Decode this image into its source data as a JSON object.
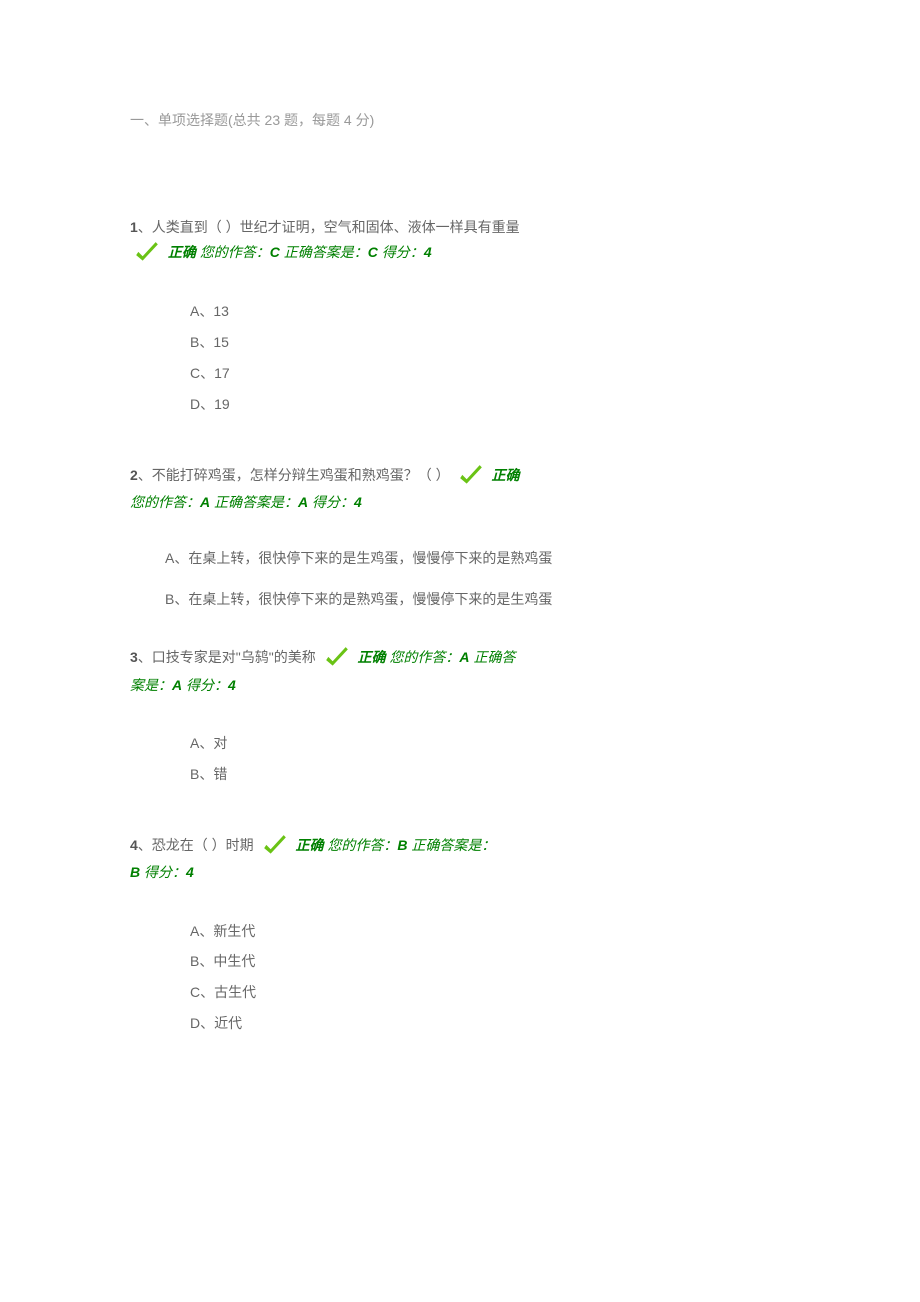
{
  "section_title": "一、单项选择题(总共 23 题，每题 4 分)",
  "correct_label": "正确",
  "answer_prefix": "您的作答：",
  "correct_answer_prefix": "正确答案是：",
  "score_prefix": "得分：",
  "questions": [
    {
      "num": "1",
      "sep": "、",
      "text": "人类直到（ ）世纪才证明，空气和固体、液体一样具有重量",
      "your_answer": "C",
      "correct_answer": "C",
      "score": "4",
      "options": [
        {
          "label": "A、",
          "text": "13"
        },
        {
          "label": "B、",
          "text": "15"
        },
        {
          "label": "C、",
          "text": "17"
        },
        {
          "label": "D、",
          "text": "19"
        }
      ]
    },
    {
      "num": "2",
      "sep": "、",
      "text": "不能打碎鸡蛋，怎样分辩生鸡蛋和熟鸡蛋？（ ）",
      "your_answer": "A",
      "correct_answer": "A",
      "score": "4",
      "options": [
        {
          "label": "A、",
          "text": "在桌上转，很快停下来的是生鸡蛋，慢慢停下来的是熟鸡蛋"
        },
        {
          "label": "B、",
          "text": "在桌上转，很快停下来的是熟鸡蛋，慢慢停下来的是生鸡蛋"
        }
      ]
    },
    {
      "num": "3",
      "sep": "、",
      "text": "口技专家是对\"乌鸫\"的美称",
      "your_answer": "A",
      "correct_answer": "A",
      "score": "4",
      "options": [
        {
          "label": "A、",
          "text": "对"
        },
        {
          "label": "B、",
          "text": "错"
        }
      ]
    },
    {
      "num": "4",
      "sep": "、",
      "text": "恐龙在（ ）时期",
      "your_answer": "B",
      "correct_answer": "B",
      "score": "4",
      "options": [
        {
          "label": "A、",
          "text": "新生代"
        },
        {
          "label": "B、",
          "text": "中生代"
        },
        {
          "label": "C、",
          "text": "古生代"
        },
        {
          "label": "D、",
          "text": "近代"
        }
      ]
    }
  ]
}
